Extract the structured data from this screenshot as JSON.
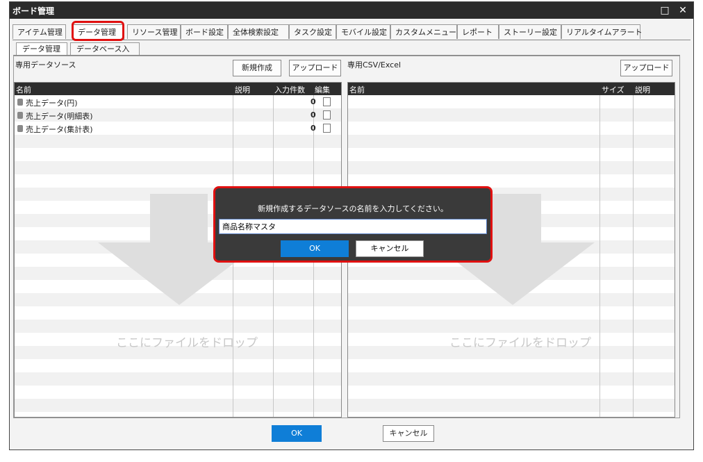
{
  "window": {
    "title": "ボード管理",
    "maximize_glyph": "□",
    "close_glyph": "✕"
  },
  "main_tabs": [
    {
      "label": "アイテム管理"
    },
    {
      "label": "データ管理"
    },
    {
      "label": "リソース管理"
    },
    {
      "label": "ボード設定"
    },
    {
      "label": "全体検索設定"
    },
    {
      "label": "タスク設定"
    },
    {
      "label": "モバイル設定"
    },
    {
      "label": "カスタムメニュー"
    },
    {
      "label": "レポート"
    },
    {
      "label": "ストーリー設定"
    },
    {
      "label": "リアルタイムアラート"
    }
  ],
  "sub_tabs": [
    {
      "label": "データ管理"
    },
    {
      "label": "データベース入力"
    }
  ],
  "left_panel": {
    "label": "専用データソース",
    "new_button": "新規作成",
    "upload_button": "アップロード",
    "columns": [
      "名前",
      "説明",
      "入力件数",
      "編集"
    ],
    "rows": [
      {
        "name": "売上データ(円)",
        "count": "0"
      },
      {
        "name": "売上データ(明細表)",
        "count": "0"
      },
      {
        "name": "売上データ(集計表)",
        "count": "0"
      }
    ],
    "drop_text": "ここにファイルをドロップ"
  },
  "right_panel": {
    "label": "専用CSV/Excel",
    "upload_button": "アップロード",
    "columns": [
      "名前",
      "サイズ",
      "説明"
    ],
    "drop_text": "ここにファイルをドロップ"
  },
  "dialog": {
    "message": "新規作成するデータソースの名前を入力してください。",
    "input_value": "商品名称マスタ",
    "ok_label": "OK",
    "cancel_label": "キャンセル"
  },
  "footer": {
    "ok_label": "OK",
    "cancel_label": "キャンセル"
  },
  "colors": {
    "accent": "#0f7ed7",
    "highlight": "#e01010",
    "header_bg": "#2d2d2d"
  }
}
